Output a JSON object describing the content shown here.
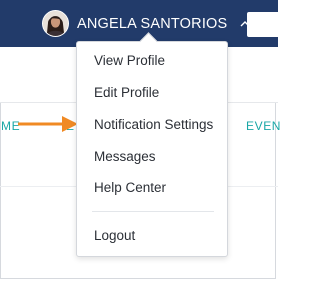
{
  "header": {
    "user_name": "ANGELA SANTORIOS",
    "avatar_icon": "user-avatar-photo",
    "chevron_icon": "chevron-up-icon",
    "bar_color": "#223b6a"
  },
  "nav": {
    "home_partial": "ME",
    "b_partial": "E",
    "events_partial": "EVEN",
    "link_color": "#1aa7a6"
  },
  "annotation": {
    "arrow_color": "#f08a24",
    "arrow_icon": "arrow-right-icon"
  },
  "user_menu": {
    "items": [
      {
        "label": "View Profile"
      },
      {
        "label": "Edit Profile"
      },
      {
        "label": "Notification Settings"
      },
      {
        "label": "Messages"
      },
      {
        "label": "Help Center"
      },
      {
        "label": "Logout"
      }
    ]
  }
}
